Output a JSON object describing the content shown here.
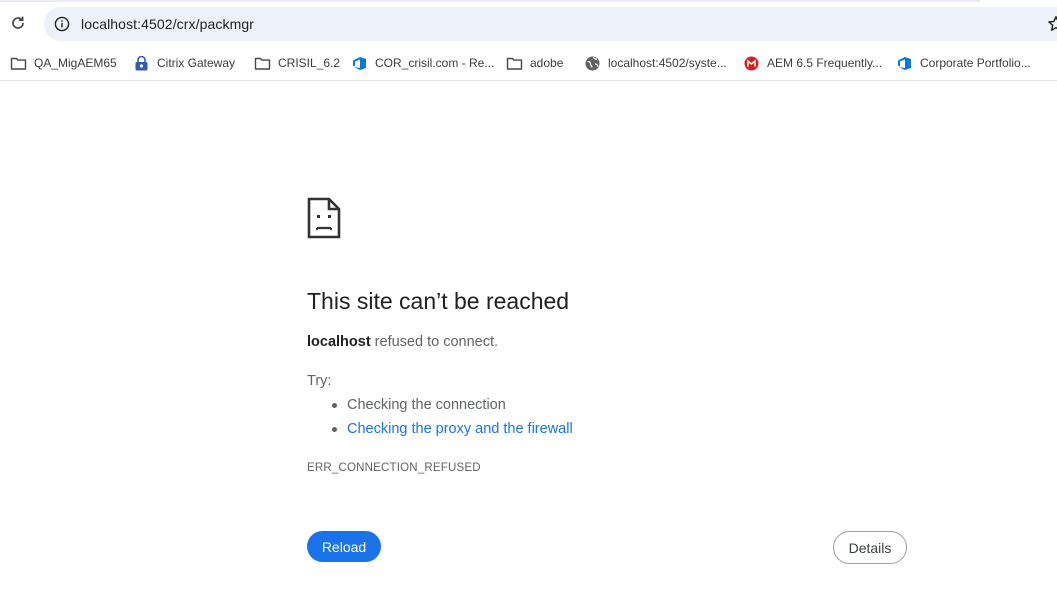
{
  "browser": {
    "url": "localhost:4502/crx/packmgr",
    "reload_icon": "reload-icon",
    "info_icon": "info-icon",
    "star_icon": "bookmark-star-icon"
  },
  "bookmarks": [
    {
      "label": "QA_MigAEM65",
      "icon": "folder-icon"
    },
    {
      "label": "Citrix Gateway",
      "icon": "citrix-lock-icon"
    },
    {
      "label": "CRISIL_6.2",
      "icon": "folder-icon"
    },
    {
      "label": "COR_crisil.com - Re...",
      "icon": "azure-devops-icon"
    },
    {
      "label": "adobe",
      "icon": "folder-icon"
    },
    {
      "label": "localhost:4502/syste...",
      "icon": "globe-icon"
    },
    {
      "label": "AEM 6.5 Frequently...",
      "icon": "red-site-icon"
    },
    {
      "label": "Corporate Portfolio...",
      "icon": "azure-devops-icon"
    }
  ],
  "error": {
    "icon": "sad-page-icon",
    "title": "This site can’t be reached",
    "host": "localhost",
    "message": " refused to connect.",
    "try_label": "Try:",
    "suggestions": [
      {
        "text": "Checking the connection",
        "link": false
      },
      {
        "text": "Checking the proxy and the firewall",
        "link": true
      }
    ],
    "code": "ERR_CONNECTION_REFUSED",
    "reload_label": "Reload",
    "details_label": "Details"
  },
  "colors": {
    "accent": "#1a73e8",
    "omnibox_bg": "#edf1fa",
    "text_secondary": "#5f6368"
  }
}
